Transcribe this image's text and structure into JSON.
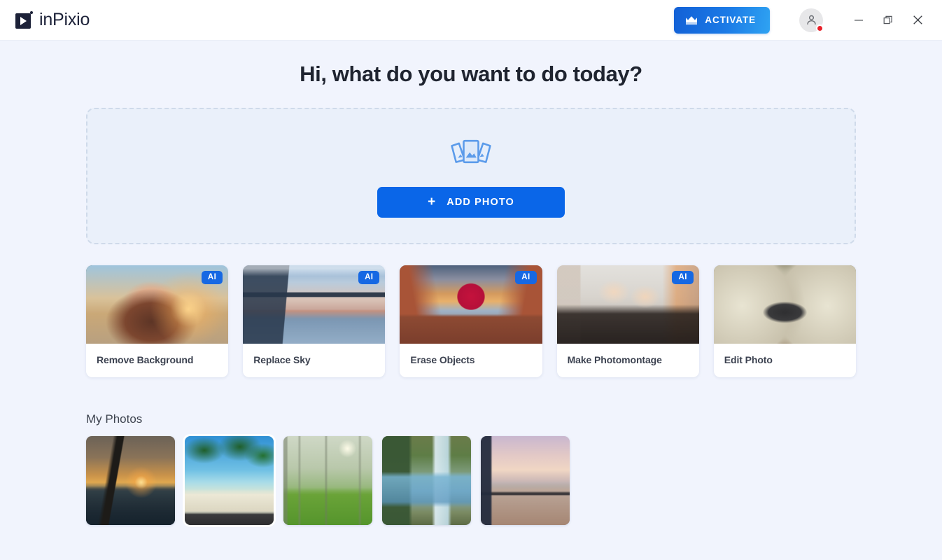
{
  "app": {
    "brand_name": "inPixio"
  },
  "titlebar": {
    "activate_label": "ACTIVATE",
    "crown_icon": "crown-icon",
    "avatar_icon": "user-avatar-icon",
    "notification_badge": "red-dot",
    "minimize_label": "Minimize",
    "restore_label": "Restore",
    "close_label": "Close",
    "accent_gradient_from": "#1260d6",
    "accent_gradient_to": "#2fa3f2",
    "badge_color": "#e8202a"
  },
  "main": {
    "page_title": "Hi, what do you want to do today?",
    "dropzone": {
      "icon": "photo-stack-icon",
      "add_photo_label": "ADD PHOTO",
      "plus_glyph": "+",
      "button_color": "#0a66e8",
      "border_color": "#cfdaea",
      "fill_color": "#eaf0fa"
    },
    "ai_badge_label": "AI",
    "ai_badge_color": "#1668e3",
    "cards": [
      {
        "label": "Remove Background",
        "ai": true,
        "art": "art-portrait"
      },
      {
        "label": "Replace Sky",
        "ai": true,
        "art": "art-bridge"
      },
      {
        "label": "Erase Objects",
        "ai": true,
        "art": "art-balloon"
      },
      {
        "label": "Make Photomontage",
        "ai": true,
        "art": "art-friends"
      },
      {
        "label": "Edit Photo",
        "ai": false,
        "art": "art-car"
      }
    ],
    "my_photos": {
      "title": "My Photos",
      "thumbnails": [
        {
          "name": "sailboat-sunset",
          "art": "art-sailboat",
          "selected": false
        },
        {
          "name": "vw-bus-palms",
          "art": "art-bus",
          "selected": true
        },
        {
          "name": "kids-misty-field",
          "art": "art-forest",
          "selected": false
        },
        {
          "name": "boy-waterfall",
          "art": "art-waterfall",
          "selected": false
        },
        {
          "name": "bicycle-beach",
          "art": "art-bicycle",
          "selected": false
        }
      ]
    }
  },
  "page": {
    "background_color": "#f1f4fd"
  }
}
